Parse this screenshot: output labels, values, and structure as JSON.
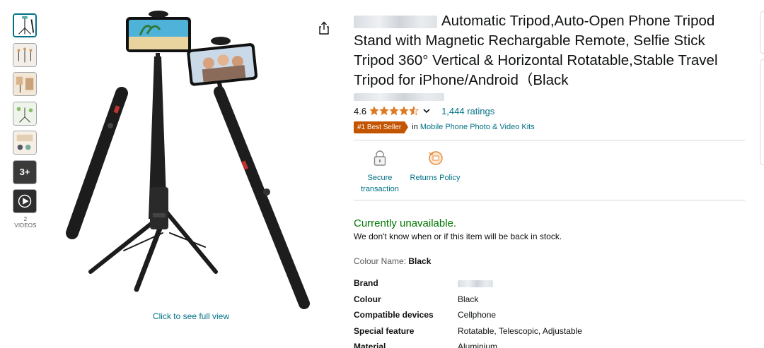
{
  "product": {
    "title": "Automatic Tripod,Auto-Open Phone Tripod Stand with Magnetic Rechargable Remote, Selfie Stick Tripod 360° Vertical & Horizontal Rotatable,Stable Travel Tripod for iPhone/Android（Black",
    "rating": "4.6",
    "stars_filled": 4.6,
    "ratings_count": "1,444 ratings",
    "badge": "#1 Best Seller",
    "badge_category_prefix": "in",
    "badge_category": "Mobile Phone Photo & Video Kits",
    "availability": "Currently unavailable.",
    "availability_note": "We don't know when or if this item will be back in stock.",
    "colour_label": "Colour Name:",
    "colour_value": "Black"
  },
  "gallery": {
    "more_label": "3+",
    "videos_label": "2 VIDEOS",
    "full_view_label": "Click to see full view"
  },
  "trust": [
    {
      "label": "Secure transaction",
      "icon": "lock-icon"
    },
    {
      "label": "Returns Policy",
      "icon": "returns-icon"
    }
  ],
  "specs": [
    {
      "key": "Brand",
      "value": ""
    },
    {
      "key": "Colour",
      "value": "Black"
    },
    {
      "key": "Compatible devices",
      "value": "Cellphone"
    },
    {
      "key": "Special feature",
      "value": "Rotatable, Telescopic, Adjustable"
    },
    {
      "key": "Material",
      "value": "Aluminium"
    }
  ],
  "colors": {
    "link": "#007185",
    "available_green": "#007600",
    "badge": "#c45500",
    "star": "#de7921"
  }
}
